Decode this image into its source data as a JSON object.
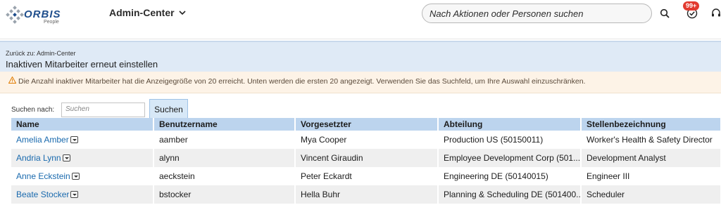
{
  "header": {
    "logo_text": "ORBIS",
    "logo_sub": "People",
    "app_title": "Admin-Center",
    "search_placeholder": "Nach Aktionen oder Personen suchen",
    "badge": "99+"
  },
  "subheader": {
    "back_link": "Zurück zu: Admin-Center",
    "page_title": "Inaktiven Mitarbeiter erneut einstellen"
  },
  "warning": {
    "text": "Die Anzahl inaktiver Mitarbeiter hat die Anzeigegröße von 20 erreicht. Unten werden die ersten 20 angezeigt. Verwenden Sie das Suchfeld, um Ihre Auswahl einzuschränken."
  },
  "search": {
    "label": "Suchen nach:",
    "placeholder": "Suchen",
    "button": "Suchen"
  },
  "table": {
    "columns": [
      "Name",
      "Benutzername",
      "Vorgesetzter",
      "Abteilung",
      "Stellenbezeichnung"
    ],
    "rows": [
      [
        "Amelia Amber",
        "aamber",
        "Mya Cooper",
        "Production US (50150011)",
        "Worker's Health & Safety Director"
      ],
      [
        "Andria Lynn",
        "alynn",
        "Vincent Giraudin",
        "Employee Development Corp (501......",
        "Development Analyst"
      ],
      [
        "Anne Eckstein",
        "aeckstein",
        "Peter Eckardt",
        "Engineering DE (50140015)",
        "Engineer III"
      ],
      [
        "Beate Stocker",
        "bstocker",
        "Hella Buhr",
        "Planning & Scheduling DE (501400......",
        "Scheduler"
      ]
    ]
  },
  "colors": {
    "header_bg": "#ffffff",
    "subheader_bg": "#dfeaf6",
    "warning_bg": "#fdf3e7",
    "table_header_bg": "#bcd4ee",
    "link": "#1a6aae",
    "badge": "#e23a2f"
  }
}
